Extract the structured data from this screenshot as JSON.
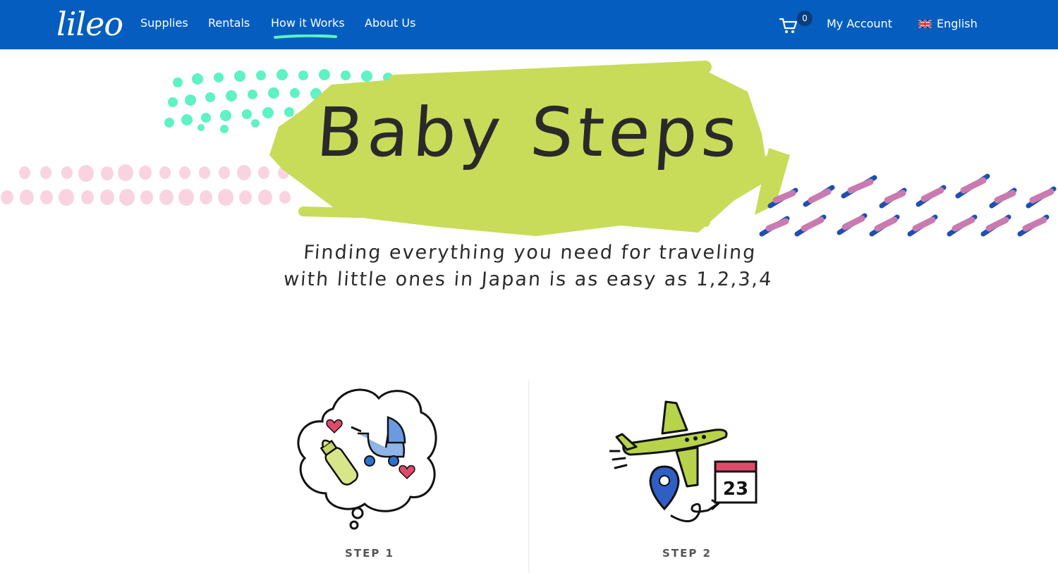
{
  "nav": {
    "logo": "lileo",
    "links": [
      "Supplies",
      "Rentals",
      "How it Works",
      "About Us"
    ],
    "active_link": "How it Works",
    "cart_count": "0",
    "account": "My Account",
    "language": "English"
  },
  "hero": {
    "title": "Baby Steps",
    "subtitle_line1": "Finding everything you need for traveling",
    "subtitle_line2": "with little ones in Japan is as easy as 1,2,3,4"
  },
  "steps": [
    {
      "label": "STEP 1",
      "icon": "baby-supplies-thought-bubble"
    },
    {
      "label": "STEP 2",
      "icon": "airplane-location-calendar"
    }
  ],
  "calendar_day": "23",
  "colors": {
    "nav_bg": "#055ebf",
    "accent_teal": "#5ef2c4",
    "brush_green": "#c8dc5a",
    "dot_pink": "#f9d4e0",
    "stroke_blue": "#1f4fb0",
    "stroke_mauve": "#c97bb0"
  }
}
